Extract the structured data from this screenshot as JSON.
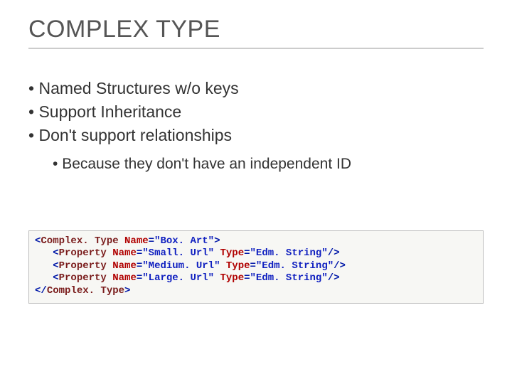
{
  "title": "COMPLEX TYPE",
  "bullets": [
    "Named Structures w/o keys",
    "Support Inheritance",
    "Don't support relationships"
  ],
  "sub_bullets": [
    "Because they don't have an independent ID"
  ],
  "code": {
    "open_tag": "Complex. Type",
    "open_attr_name": "Name",
    "open_attr_val": "\"Box. Art\"",
    "props": [
      {
        "tag": "Property",
        "name_attr": "Name",
        "name_val": "\"Small. Url\"",
        "type_attr": "Type",
        "type_val": "\"Edm. String\""
      },
      {
        "tag": "Property",
        "name_attr": "Name",
        "name_val": "\"Medium. Url\"",
        "type_attr": "Type",
        "type_val": "\"Edm. String\""
      },
      {
        "tag": "Property",
        "name_attr": "Name",
        "name_val": "\"Large. Url\"",
        "type_attr": "Type",
        "type_val": "\"Edm. String\""
      }
    ],
    "close_tag": "Complex. Type"
  }
}
